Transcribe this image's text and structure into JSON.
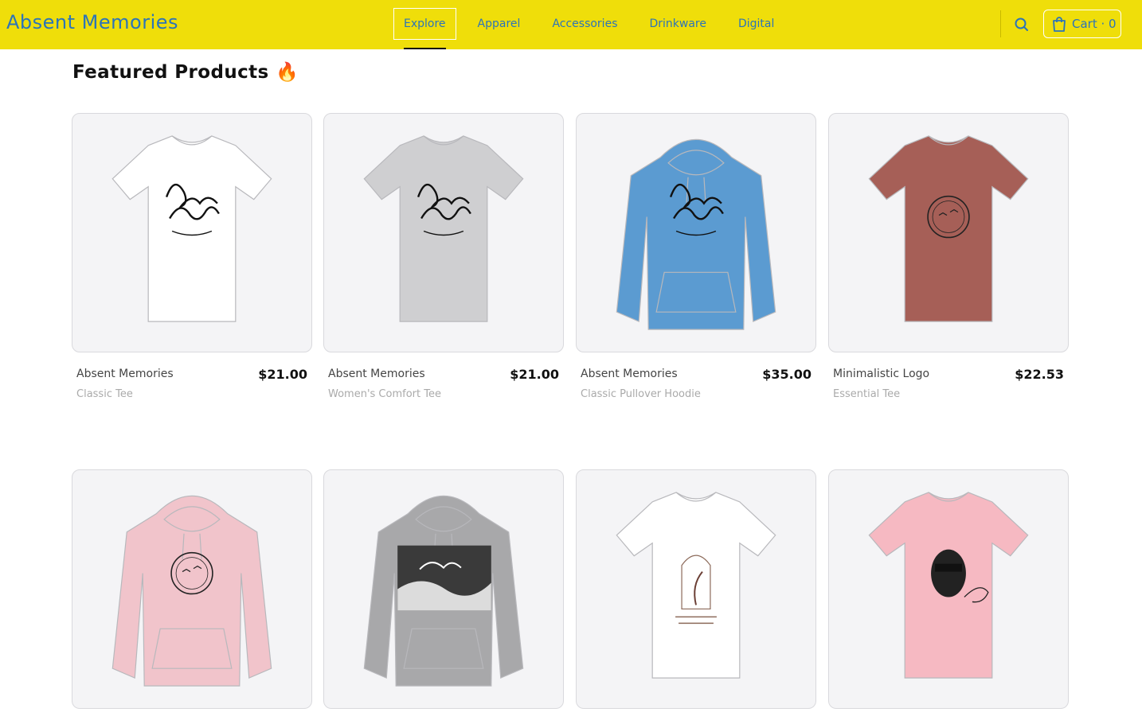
{
  "header": {
    "brand": "Absent Memories",
    "nav": [
      {
        "label": "Explore",
        "active": true
      },
      {
        "label": "Apparel",
        "active": false
      },
      {
        "label": "Accessories",
        "active": false
      },
      {
        "label": "Drinkware",
        "active": false
      },
      {
        "label": "Digital",
        "active": false
      }
    ],
    "cart_label": "Cart · 0",
    "icons": {
      "search": "search-icon",
      "cart": "shopping-bag-icon"
    }
  },
  "colors": {
    "header_bg": "#efde0a",
    "accent": "#2c74b8"
  },
  "page_title": "Featured Products 🔥",
  "products": [
    {
      "name": "Absent Memories",
      "type": "Classic Tee",
      "price": "$21.00",
      "garment": "tee",
      "color": "#ffffff",
      "print": "script-logo"
    },
    {
      "name": "Absent Memories",
      "type": "Women's Comfort Tee",
      "price": "$21.00",
      "garment": "tee",
      "color": "#cfcfd1",
      "print": "script-logo"
    },
    {
      "name": "Absent Memories",
      "type": "Classic Pullover Hoodie",
      "price": "$35.00",
      "garment": "hoodie",
      "color": "#5b9bd1",
      "print": "script-logo"
    },
    {
      "name": "Minimalistic Logo",
      "type": "Essential Tee",
      "price": "$22.53",
      "garment": "tee",
      "color": "#a65f57",
      "print": "circle-logo"
    },
    {
      "name": "",
      "type": "",
      "price": "",
      "garment": "hoodie",
      "color": "#f1c4cb",
      "print": "circle-logo"
    },
    {
      "name": "",
      "type": "",
      "price": "",
      "garment": "hoodie",
      "color": "#a8a8aa",
      "print": "photo-logo"
    },
    {
      "name": "",
      "type": "",
      "price": "",
      "garment": "tee",
      "color": "#ffffff",
      "print": "arch-logo"
    },
    {
      "name": "",
      "type": "",
      "price": "",
      "garment": "tee",
      "color": "#f6b9c2",
      "print": "portrait-logo"
    }
  ]
}
